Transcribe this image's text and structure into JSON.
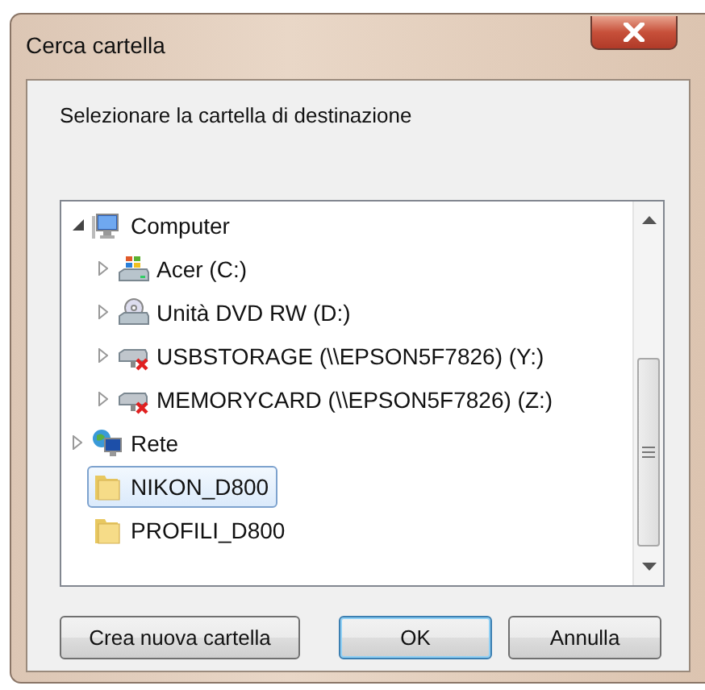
{
  "window": {
    "title": "Cerca cartella"
  },
  "prompt": "Selezionare la cartella di destinazione",
  "tree": [
    {
      "label": "Computer",
      "kind": "computer",
      "expanded": true,
      "selected": false,
      "children": [
        {
          "label": "Acer (C:)",
          "kind": "drive",
          "expanded": false,
          "selected": false
        },
        {
          "label": "Unità DVD RW (D:)",
          "kind": "dvd",
          "expanded": false,
          "selected": false
        },
        {
          "label": "USBSTORAGE (\\\\EPSON5F7826) (Y:)",
          "kind": "network-drive",
          "expanded": false,
          "selected": false
        },
        {
          "label": "MEMORYCARD (\\\\EPSON5F7826) (Z:)",
          "kind": "network-drive",
          "expanded": false,
          "selected": false
        }
      ]
    },
    {
      "label": "Rete",
      "kind": "network",
      "expanded": false,
      "selected": false
    },
    {
      "label": "NIKON_D800",
      "kind": "folder",
      "selected": true
    },
    {
      "label": "PROFILI_D800",
      "kind": "folder",
      "selected": false
    }
  ],
  "buttons": [
    {
      "label": "Crea nuova cartella",
      "default": false
    },
    {
      "label": "OK",
      "default": true
    },
    {
      "label": "Annulla",
      "default": false
    }
  ]
}
